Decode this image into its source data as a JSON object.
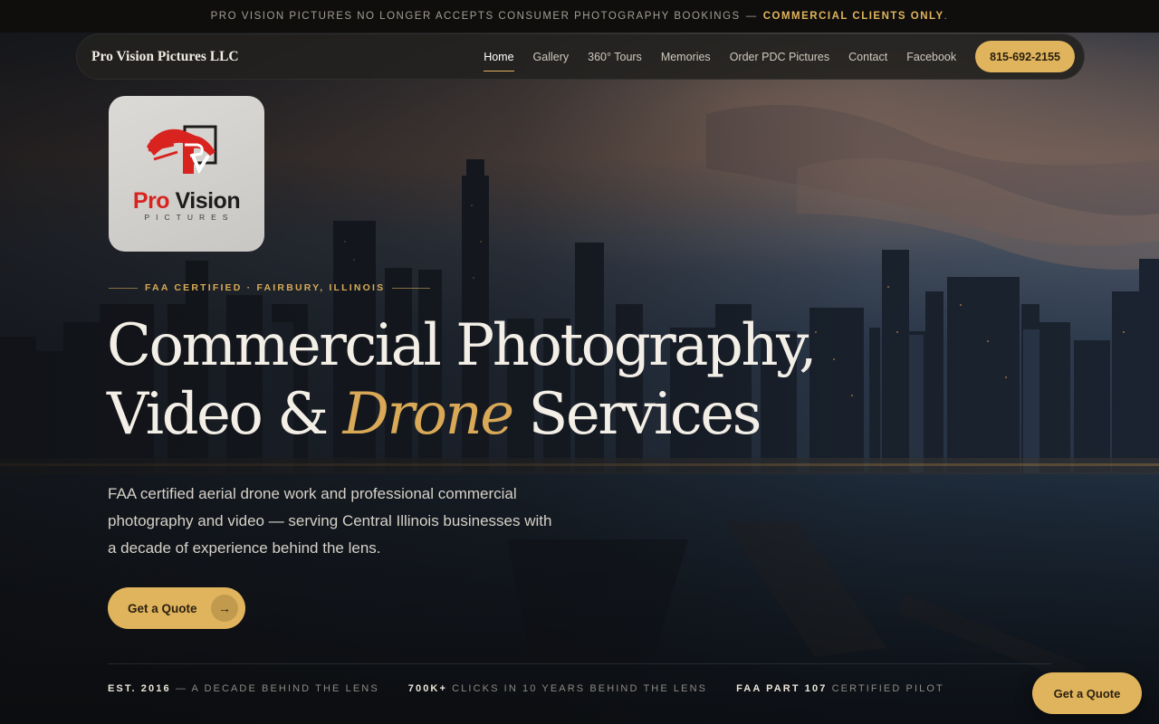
{
  "announcement": {
    "text": "PRO VISION PICTURES NO LONGER ACCEPTS CONSUMER PHOTOGRAPHY BOOKINGS",
    "separator": "—",
    "highlight": "COMMERCIAL CLIENTS ONLY",
    "tail": "."
  },
  "nav": {
    "brand": "Pro Vision Pictures LLC",
    "items": [
      {
        "label": "Home",
        "active": true
      },
      {
        "label": "Gallery"
      },
      {
        "label": "360° Tours"
      },
      {
        "label": "Memories"
      },
      {
        "label": "Order PDC Pictures"
      },
      {
        "label": "Contact"
      },
      {
        "label": "Facebook"
      }
    ],
    "phone": "815-692-2155"
  },
  "logo": {
    "name_red": "Pro",
    "name_dark": "Vision",
    "sub": "PICTURES"
  },
  "hero": {
    "eyebrow": "FAA CERTIFIED · FAIRBURY, ILLINOIS",
    "headline_line1": "Commercial Photography,",
    "headline_line2_a": "Video & ",
    "headline_line2_em": "Drone",
    "headline_line2_b": " Services",
    "lede": "FAA certified aerial drone work and professional commercial photography and video — serving Central Illinois businesses with a decade of experience behind the lens.",
    "cta_label": "Get a Quote",
    "cta_arrow": "→"
  },
  "stats": [
    {
      "bold": "EST. 2016",
      "rest": "— A DECADE BEHIND THE LENS"
    },
    {
      "bold": "700K+",
      "rest": "CLICKS IN 10 YEARS BEHIND THE LENS"
    },
    {
      "bold": "FAA PART 107",
      "rest": "CERTIFIED PILOT"
    }
  ],
  "floating_cta": "Get a Quote",
  "colors": {
    "accent_gold": "#e0b45c",
    "logo_red": "#d8231f",
    "topbar_bg": "#0f0e0d"
  }
}
